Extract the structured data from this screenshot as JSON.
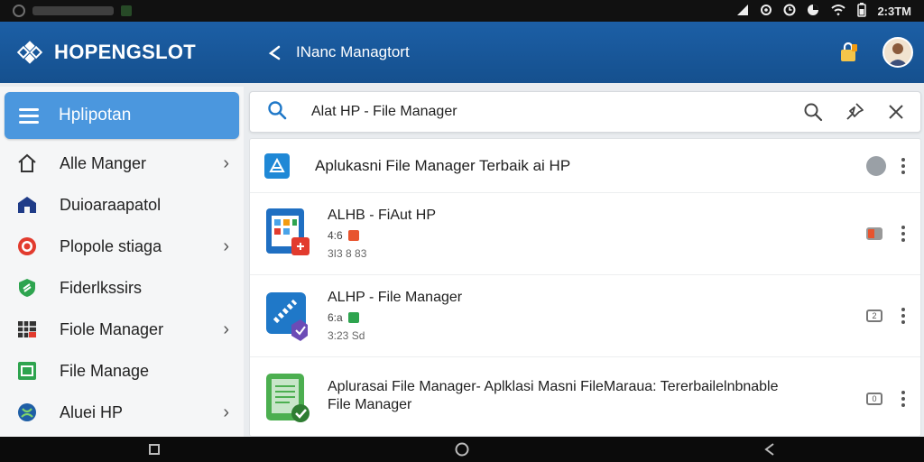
{
  "status_bar": {
    "time": "2:3TM"
  },
  "app_bar": {
    "brand": "HOPENGSLOT",
    "title": "INanc Managtort"
  },
  "sidebar": {
    "header_label": "Hplipotan",
    "items": [
      {
        "label": "Alle Manger",
        "icon": "home-icon",
        "chevron": true
      },
      {
        "label": "Duioaraapatol",
        "icon": "building-icon",
        "chevron": false
      },
      {
        "label": "Plopole stiaga",
        "icon": "target-icon",
        "chevron": true
      },
      {
        "label": "Fiderlkssirs",
        "icon": "shield-icon",
        "chevron": false
      },
      {
        "label": "Fiole Manager",
        "icon": "grid-icon",
        "chevron": true
      },
      {
        "label": "File Manage",
        "icon": "file-icon",
        "chevron": false
      },
      {
        "label": "Aluei HP",
        "icon": "globe-icon",
        "chevron": true
      }
    ]
  },
  "search": {
    "value": "Alat HP - File Manager"
  },
  "panel": {
    "title": "Aplukasni File Manager Terbaik ai HP",
    "apps": [
      {
        "name": "ALHB - FiAut HP",
        "meta1": "4:6",
        "meta2": "3I3 8 83",
        "badge": ""
      },
      {
        "name": "ALHP - File Manager",
        "meta1": "6:a",
        "meta2": "3:23 Sd",
        "badge": "2"
      },
      {
        "name": "Aplurasai File Manager- Aplklasi Masni FileMaraua: Tererbailelnbnable",
        "name2": "File Manager",
        "badge": "0"
      }
    ]
  },
  "colors": {
    "primary": "#1c5fa6",
    "accent": "#4b97de"
  }
}
